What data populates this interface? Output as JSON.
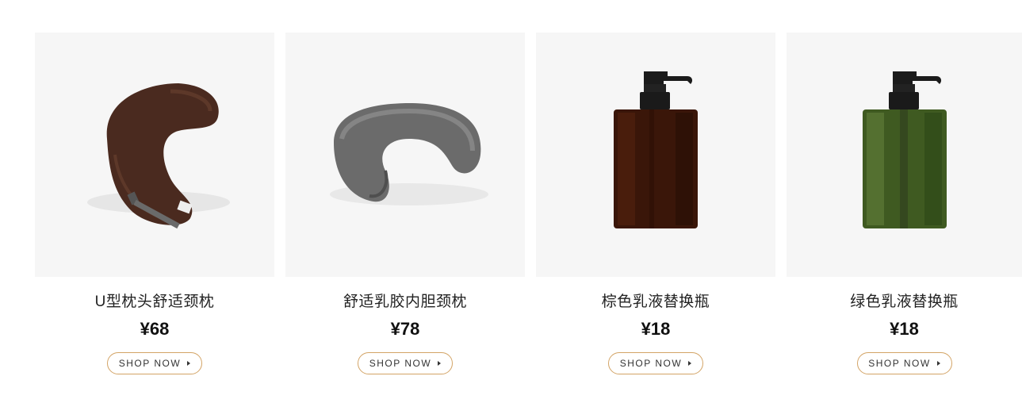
{
  "products": [
    {
      "name": "U型枕头舒适颈枕",
      "price": "¥68",
      "cta": "SHOP NOW",
      "image": "brown-u-pillow"
    },
    {
      "name": "舒适乳胶内胆颈枕",
      "price": "¥78",
      "cta": "SHOP NOW",
      "image": "grey-u-pillow"
    },
    {
      "name": "棕色乳液替换瓶",
      "price": "¥18",
      "cta": "SHOP NOW",
      "image": "brown-pump-bottle"
    },
    {
      "name": "绿色乳液替换瓶",
      "price": "¥18",
      "cta": "SHOP NOW",
      "image": "green-pump-bottle"
    }
  ],
  "colors": {
    "card_bg": "#f6f6f6",
    "button_border": "#d3a466",
    "text": "#222222"
  },
  "icons": {
    "cta_arrow": "caret-right-icon"
  }
}
